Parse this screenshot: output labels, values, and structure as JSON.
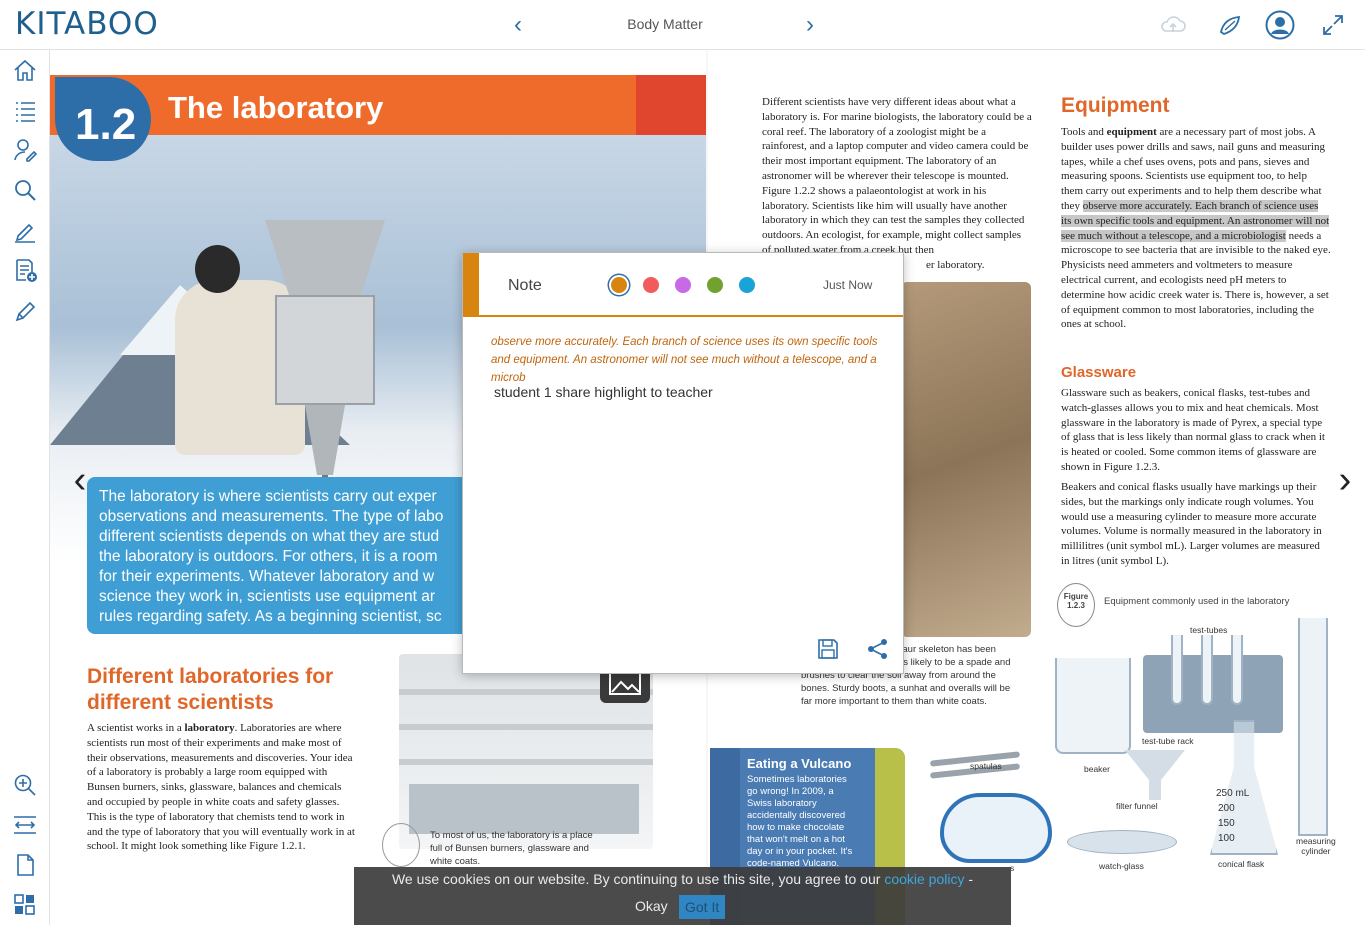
{
  "app": {
    "logo": "KITABOO",
    "toc_title": "Body Matter",
    "nav_prev": "‹",
    "nav_next": "›"
  },
  "icons": {
    "top": [
      "upload-cloud-icon",
      "palette-icon",
      "user-profile-icon",
      "fullscreen-icon"
    ],
    "sidebar": [
      "home-icon",
      "toc-list-icon",
      "my-data-icon",
      "search-icon",
      "pen-annotate-icon",
      "add-note-icon",
      "highlighter-icon",
      "zoom-in-icon",
      "fit-width-icon",
      "single-page-icon",
      "thumbnail-grid-icon"
    ]
  },
  "left_page": {
    "section_number": "1.2",
    "title": "The laboratory",
    "intro": "The laboratory is where scientists carry out exper\nobservations and measurements. The type of labo\ndifferent scientists depends on what they are stud\nthe laboratory is outdoors. For others, it is a room\nfor their experiments. Whatever laboratory and w\nscience they work in, scientists use equipment ar\nrules regarding safety. As a beginning scientist, sc",
    "heading": "Different laboratories for different scientists",
    "para_before_bold": "A scientist works in a ",
    "para_bold": "laboratory",
    "para_after_bold": ". Laboratories are where scientists run most of their experiments and make most of their observations, measurements and discoveries. Your idea of a laboratory is probably a large room equipped with Bunsen burners, sinks, glassware, balances and chemicals and occupied by people in white coats and safety glasses. This is the type of laboratory that chemists tend to work in and the type of laboratory that you will eventually work in at school. It might look something like Figure 1.2.1.",
    "photo_caption": "To most of us, the laboratory is a place full of Bunsen burners, glassware and white coats."
  },
  "right_page": {
    "col1_text": "Different scientists have very different ideas about what a laboratory is. For marine biologists, the laboratory could be a coral reef. The laboratory of a zoologist might be a rainforest, and a laptop computer and video camera could be their most important equipment. The laboratory of an astronomer will be wherever their telescope is mounted. Figure 1.2.2 shows a palaeontologist at work in his laboratory. Scientists like him will usually have another laboratory in which they can test the samples they collected outdoors. An ecologist, for example, might collect samples of polluted water from a creek but then",
    "col1_tail": "er laboratory.",
    "dig_caption": "he laboratory could be saur skeleton has been found. Their equipment is likely to be a spade and brushes to clear the soil away from around the bones. Sturdy boots, a sunhat and overalls will be far more important to them than white coats.",
    "equipment_heading": "Equipment",
    "equipment_p1": "Tools and ",
    "equipment_bold": "equipment",
    "equipment_p2": " are a necessary part of most jobs. A builder uses power drills and saws, nail guns and measuring tapes, while a chef uses ovens, pots and pans, sieves and measuring spoons. Scientists use equipment too, to help them carry out experiments and to help them describe what they ",
    "equipment_highlight": "observe more accurately. Each branch of science uses its own specific tools and equipment. An astronomer will not see much without a telescope, and a microbiologist",
    "equipment_p3": " needs a microscope to see bacteria that are invisible to the naked eye. Physicists need ammeters and voltmeters to measure electrical current, and ecologists need pH meters to determine how acidic creek water is. There is, however, a set of equipment common to most laboratories, including the ones at school.",
    "glassware_heading": "Glassware",
    "glassware_p1": "Glassware such as beakers, conical flasks, test-tubes and watch-glasses allows you to mix and heat chemicals. Most glassware in the laboratory is made of Pyrex, a special type of glass that is less likely than normal glass to crack when it is heated or cooled. Some common items of glassware are shown in Figure 1.2.3.",
    "glassware_p2": "Beakers and conical flasks usually have markings up their sides, but the markings only indicate rough volumes. You would use a measuring cylinder to measure more accurate volumes. Volume is normally measured in the laboratory in millilitres (unit symbol mL). Larger volumes are measured in litres (unit symbol L).",
    "figure_badge_word": "Figure",
    "figure_badge_number": "1.2.3",
    "figure_caption": "Equipment commonly used in the laboratory",
    "labels": {
      "test_tubes": "test-tubes",
      "test_tube_rack": "test-tube rack",
      "beaker": "beaker",
      "spatulas": "spatulas",
      "filter_funnel": "filter funnel",
      "watch_glass": "watch-glass",
      "conical_flask": "conical flask",
      "measuring_cylinder": "measuring\ncylinder",
      "flask_250": "250 mL",
      "flask_200": "200",
      "flask_150": "150",
      "flask_100": "100",
      "goggles_partial": "s"
    },
    "volcano_title": "Eating a Vulcano",
    "volcano_text": "Sometimes laboratories\ngo wrong! In 2009, a\nSwiss laboratory\naccidentally discovered\nhow to make chocolate\nthat won't melt on a hot\nday or in your pocket. It's\ncode-named Vulcano."
  },
  "note": {
    "label": "Note",
    "colors": [
      "#d88510",
      "#f25b5b",
      "#c66ae6",
      "#71a22f",
      "#1aa3d6"
    ],
    "selected_color": 0,
    "timestamp": "Just Now",
    "quote": "observe more accurately. Each branch of science uses its own specific tools and equipment. An astronomer will not see much without a telescope, and a microb",
    "text": "student 1 share highlight to teacher",
    "actions": [
      "save-icon",
      "share-icon"
    ]
  },
  "cookie": {
    "text_before": "We use cookies on our website. By continuing to use this site, you agree to our ",
    "link": "cookie policy",
    "text_after": " -",
    "okay": "Okay",
    "button": "Got It"
  },
  "theme": {
    "accent_blue": "#2d6ea8",
    "banner_orange": "#ef6b2c",
    "note_orange": "#d88510"
  }
}
